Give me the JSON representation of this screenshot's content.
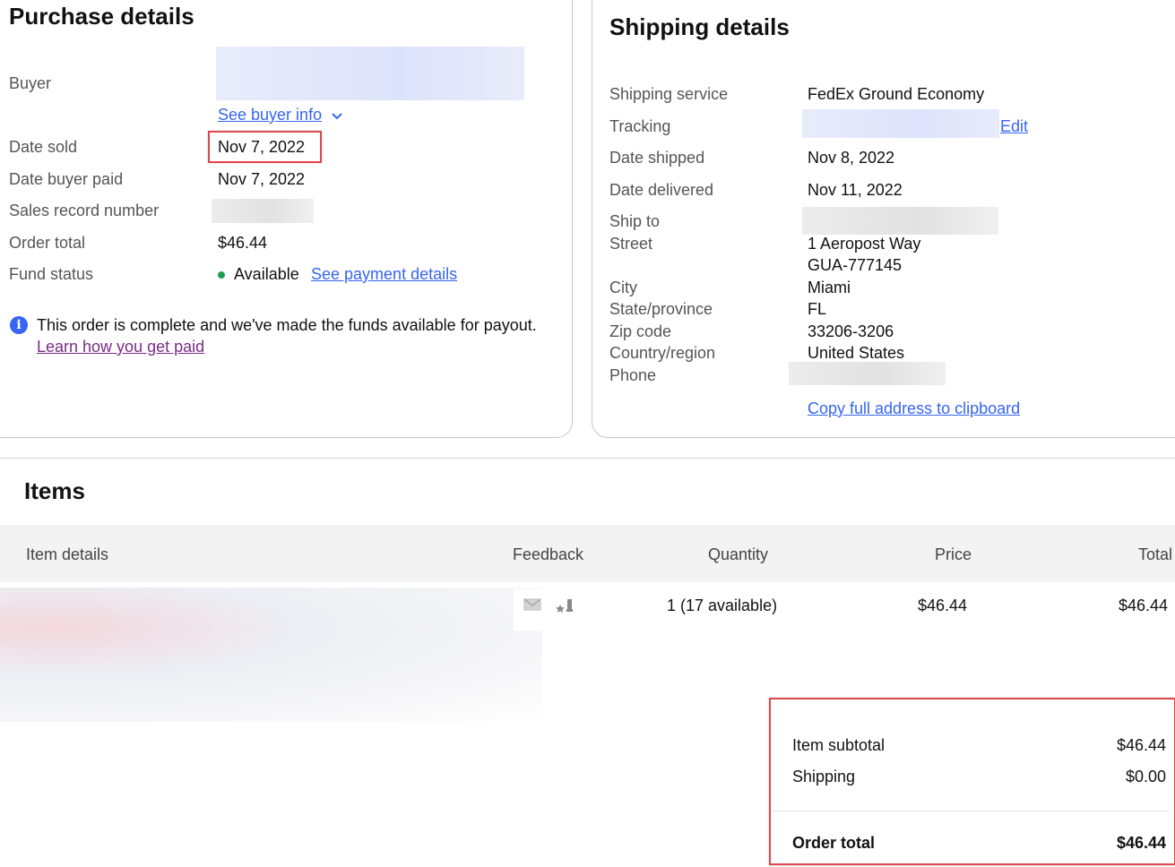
{
  "purchase": {
    "title": "Purchase details",
    "buyer_label": "Buyer",
    "see_buyer_info": "See buyer info",
    "date_sold_label": "Date sold",
    "date_sold": "Nov 7, 2022",
    "date_paid_label": "Date buyer paid",
    "date_paid": "Nov 7, 2022",
    "sales_record_label": "Sales record number",
    "order_total_label": "Order total",
    "order_total": "$46.44",
    "fund_status_label": "Fund status",
    "fund_status": "Available",
    "see_payment_details": "See payment details",
    "notice": "This order is complete and we've made the funds available for payout.",
    "learn_link": "Learn how you get paid",
    "status_color": "#1f9e55"
  },
  "shipping": {
    "title": "Shipping details",
    "service_label": "Shipping service",
    "service": "FedEx Ground Economy",
    "tracking_label": "Tracking",
    "edit": "Edit",
    "date_shipped_label": "Date shipped",
    "date_shipped": "Nov 8, 2022",
    "date_delivered_label": "Date delivered",
    "date_delivered": "Nov 11, 2022",
    "ship_to_label": "Ship to",
    "street_label": "Street",
    "street_1": "1 Aeropost Way",
    "street_2": "GUA-777145",
    "city_label": "City",
    "city": "Miami",
    "state_label": "State/province",
    "state": "FL",
    "zip_label": "Zip code",
    "zip": "33206-3206",
    "country_label": "Country/region",
    "country": "United States",
    "phone_label": "Phone",
    "copy_address": "Copy full address to clipboard"
  },
  "items": {
    "title": "Items",
    "columns": [
      "Item details",
      "Feedback",
      "Quantity",
      "Price",
      "Total"
    ],
    "row": {
      "quantity": "1 (17 available)",
      "price": "$46.44",
      "total": "$46.44"
    }
  },
  "summary": {
    "subtotal_label": "Item subtotal",
    "subtotal": "$46.44",
    "shipping_label": "Shipping",
    "shipping": "$0.00",
    "total_label": "Order total",
    "total": "$46.44"
  },
  "icons": {
    "info": "info-icon",
    "chevron": "chevron-down-icon",
    "envelope": "envelope-icon",
    "feedback": "leave-feedback-icon"
  },
  "colors": {
    "link": "#3665f3",
    "link_visited": "#7b2b84",
    "highlight": "#e0474c"
  }
}
